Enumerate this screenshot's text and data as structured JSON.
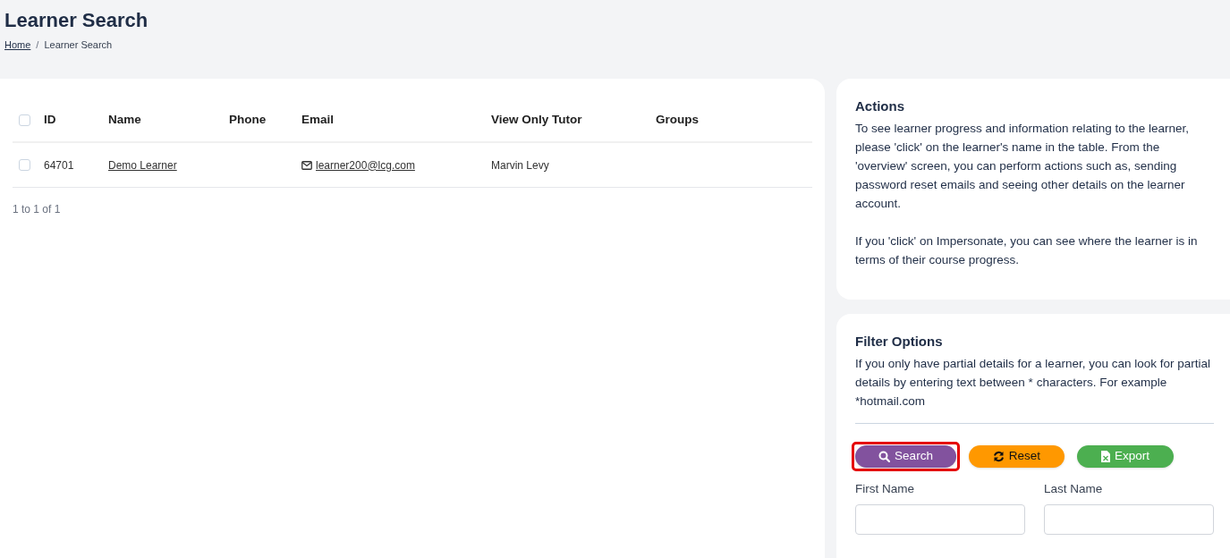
{
  "page_title": "Learner Search",
  "breadcrumb": {
    "separator": "/",
    "items": [
      {
        "label": "Home",
        "link": true
      },
      {
        "label": "Learner Search",
        "link": false
      }
    ]
  },
  "table": {
    "select_all_checked": false,
    "columns": [
      "ID",
      "Name",
      "Phone",
      "Email",
      "View Only Tutor",
      "Groups"
    ],
    "rows": [
      {
        "checked": false,
        "id": "64701",
        "name": "Demo Learner",
        "phone": "",
        "email": "learner200@lcg.com",
        "tutor": "Marvin Levy",
        "groups": ""
      }
    ],
    "pagination": "1 to 1 of 1"
  },
  "actions": {
    "title": "Actions",
    "paragraphs": [
      "To see learner progress and information relating to the learner, please 'click' on the learner's name in the table. From the 'overview' screen, you can perform actions such as, sending password reset emails and seeing other details on the learner account.",
      "If you 'click' on Impersonate, you can see where the learner is in terms of their course progress."
    ]
  },
  "filter": {
    "title": "Filter Options",
    "description": "If you only have partial details for a learner, you can look for partial details by entering text between * characters. For example *hotmail.com",
    "buttons": [
      {
        "kind": "search",
        "label": "Search",
        "highlighted": true
      },
      {
        "kind": "reset",
        "label": "Reset",
        "highlighted": false
      },
      {
        "kind": "export",
        "label": "Export",
        "highlighted": false
      }
    ],
    "fields": [
      {
        "label": "First Name"
      },
      {
        "label": "Last Name"
      }
    ]
  }
}
